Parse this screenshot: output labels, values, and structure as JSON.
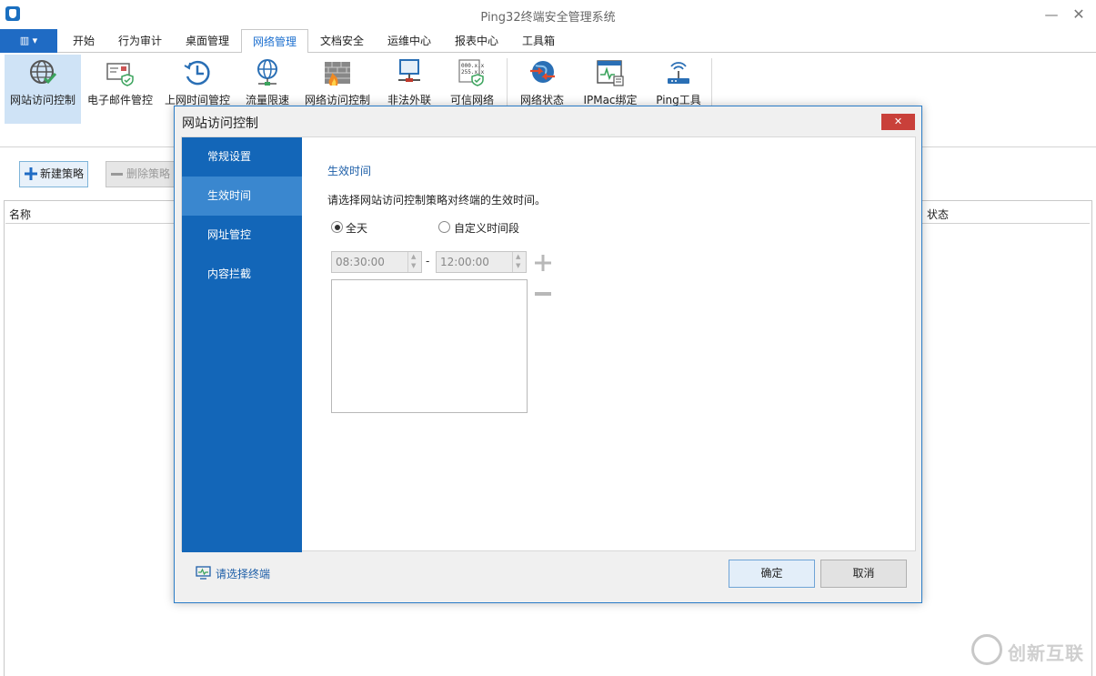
{
  "app": {
    "title": "Ping32终端安全管理系统"
  },
  "window": {
    "minimize_glyph": "—",
    "close_glyph": "✕"
  },
  "file_button": {
    "glyph": "▥ ▾"
  },
  "tabs": [
    {
      "label": "开始"
    },
    {
      "label": "行为审计"
    },
    {
      "label": "桌面管理"
    },
    {
      "label": "网络管理"
    },
    {
      "label": "文档安全"
    },
    {
      "label": "运维中心"
    },
    {
      "label": "报表中心"
    },
    {
      "label": "工具箱"
    }
  ],
  "active_tab": "网络管理",
  "ribbon": [
    {
      "label": "网站访问控制",
      "icon": "globe-check-icon"
    },
    {
      "label": "电子邮件管控",
      "icon": "mail-shield-icon"
    },
    {
      "label": "上网时间管控",
      "icon": "clock-history-icon"
    },
    {
      "label": "流量限速",
      "icon": "globe-network-icon"
    },
    {
      "label": "网络访问控制",
      "icon": "firewall-icon"
    },
    {
      "label": "非法外联",
      "icon": "network-computer-icon"
    },
    {
      "label": "可信网络",
      "icon": "trusted-network-icon"
    },
    {
      "label": "网络状态",
      "icon": "network-status-icon"
    },
    {
      "label": "IPMac绑定",
      "icon": "ipmac-icon"
    },
    {
      "label": "Ping工具",
      "icon": "router-icon"
    }
  ],
  "toolbar": {
    "new_label": "新建策略",
    "delete_label": "删除策略"
  },
  "list": {
    "col_name": "名称",
    "col_status": "状态"
  },
  "watermark": {
    "text": "创新互联"
  },
  "dialog": {
    "title": "网站访问控制",
    "close_glyph": "✕",
    "nav": [
      {
        "label": "常规设置"
      },
      {
        "label": "生效时间"
      },
      {
        "label": "网址管控"
      },
      {
        "label": "内容拦截"
      }
    ],
    "active_nav": "生效时间",
    "section_title": "生效时间",
    "description": "请选择网站访问控制策略对终端的生效时间。",
    "radio_all_day": "全天",
    "radio_custom": "自定义时间段",
    "selected_radio": "全天",
    "start_time": "08:30:00",
    "end_time": "12:00:00",
    "range_dash": "-",
    "select_terminal": "请选择终端",
    "ok_label": "确定",
    "cancel_label": "取消"
  },
  "colors": {
    "accent": "#1366b8",
    "nav_active": "#3a87cf",
    "close_red": "#c9403a"
  }
}
